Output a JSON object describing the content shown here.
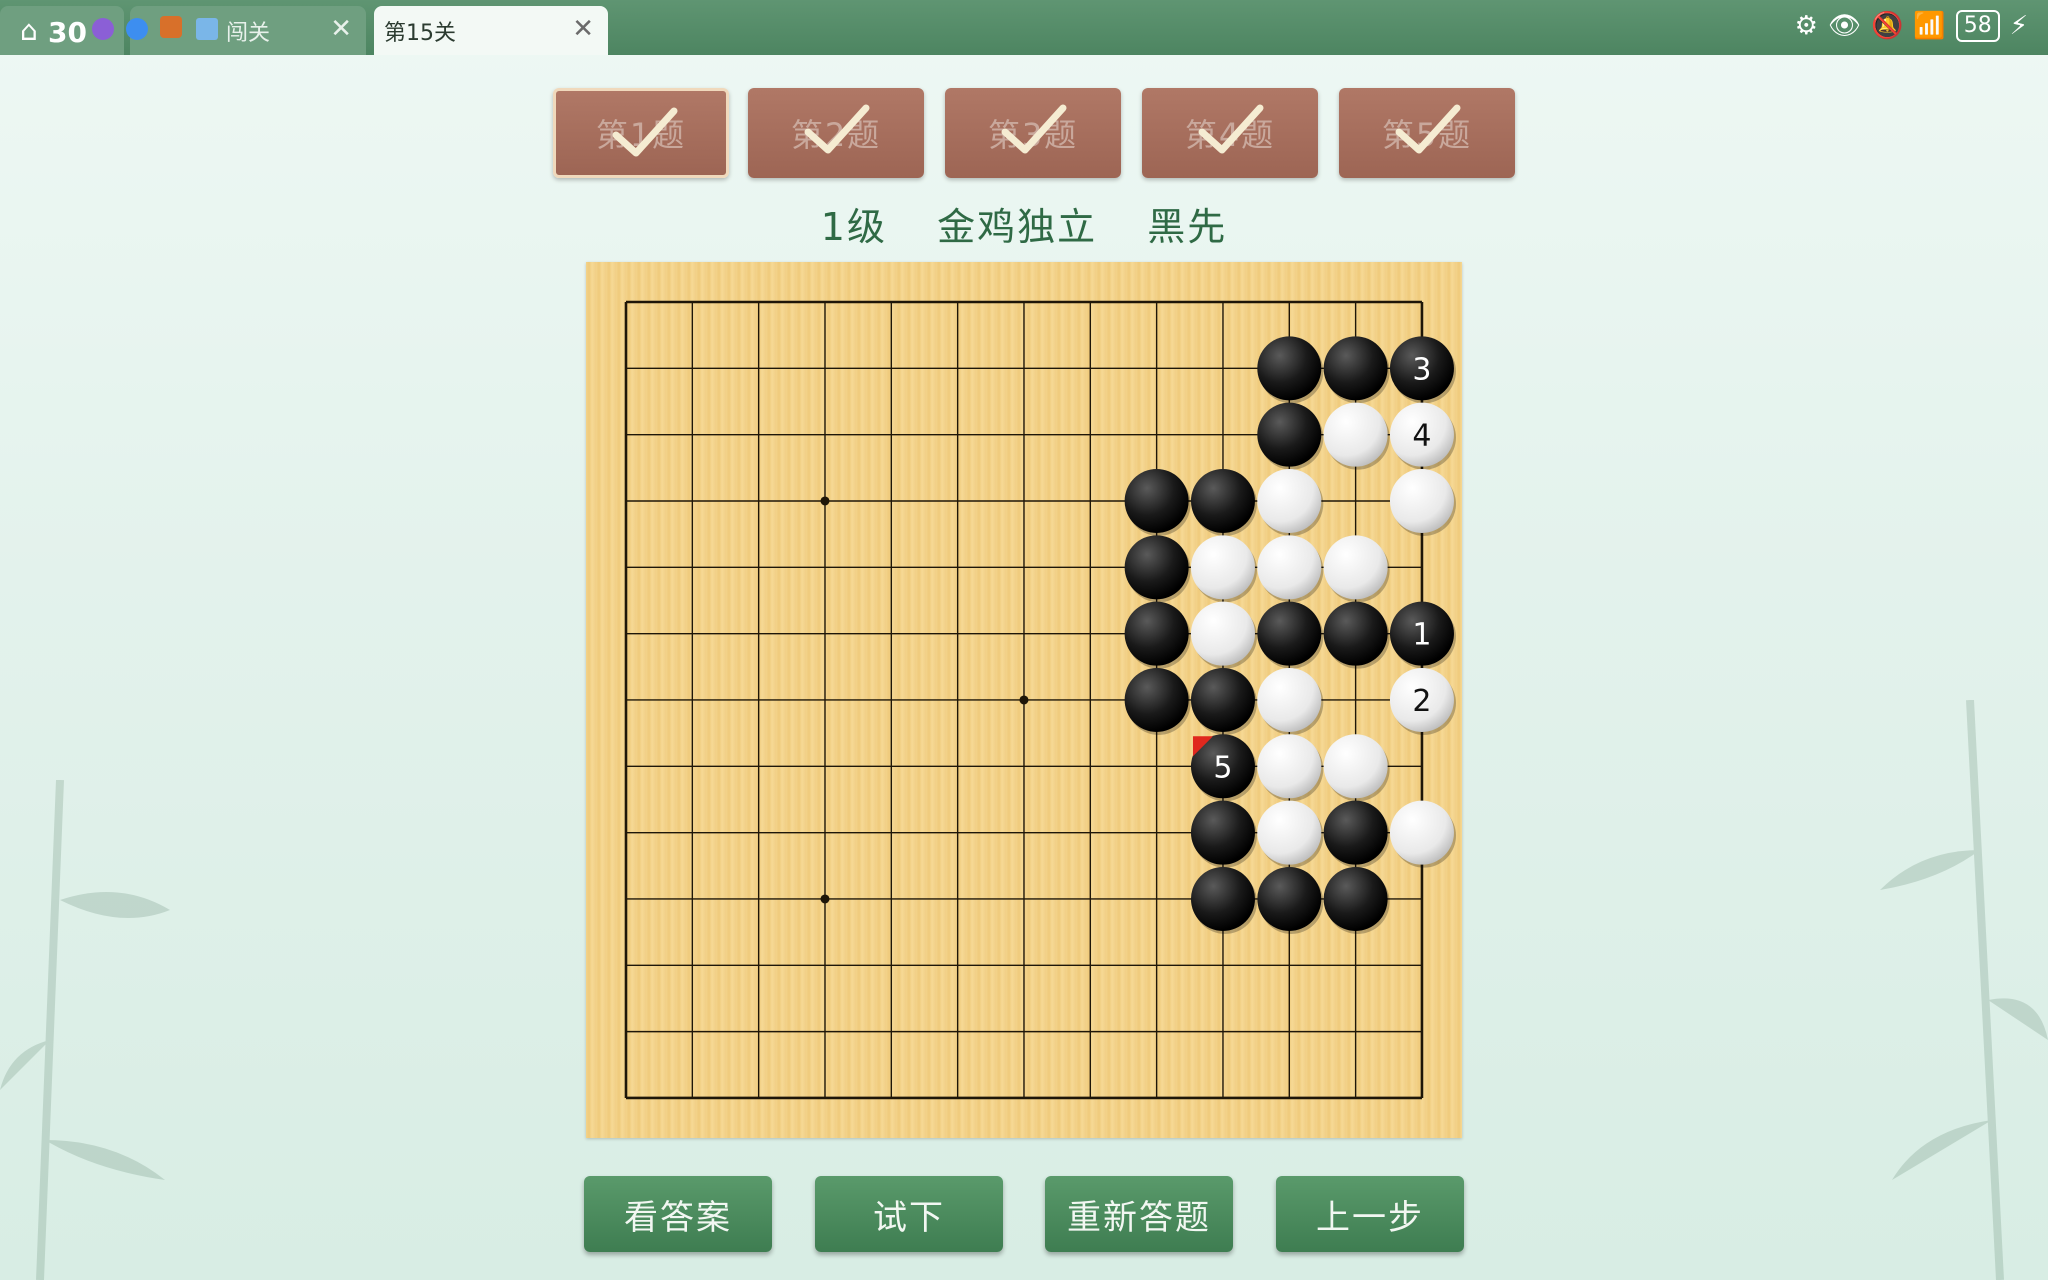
{
  "tabs": {
    "home_count": "30",
    "second_label": "闯关",
    "active_label": "第15关"
  },
  "status_bar": {
    "battery": "58"
  },
  "problems": [
    {
      "label": "第1题",
      "solved": true
    },
    {
      "label": "第2题",
      "solved": true
    },
    {
      "label": "第3题",
      "solved": true
    },
    {
      "label": "第4题",
      "solved": true
    },
    {
      "label": "第5题",
      "solved": true
    }
  ],
  "problem_info": {
    "level": "1级",
    "name": "金鸡独立",
    "turn": "黑先"
  },
  "board": {
    "size": 13,
    "star_points": [
      [
        3,
        3
      ],
      [
        6,
        6
      ],
      [
        3,
        9
      ]
    ],
    "stones": [
      {
        "col": 10,
        "row": 1,
        "color": "black"
      },
      {
        "col": 11,
        "row": 1,
        "color": "black"
      },
      {
        "col": 12,
        "row": 1,
        "color": "black",
        "number": "3"
      },
      {
        "col": 10,
        "row": 2,
        "color": "black"
      },
      {
        "col": 11,
        "row": 2,
        "color": "white"
      },
      {
        "col": 12,
        "row": 2,
        "color": "white",
        "number": "4"
      },
      {
        "col": 8,
        "row": 3,
        "color": "black"
      },
      {
        "col": 9,
        "row": 3,
        "color": "black"
      },
      {
        "col": 10,
        "row": 3,
        "color": "white"
      },
      {
        "col": 12,
        "row": 3,
        "color": "white"
      },
      {
        "col": 8,
        "row": 4,
        "color": "black"
      },
      {
        "col": 9,
        "row": 4,
        "color": "white"
      },
      {
        "col": 10,
        "row": 4,
        "color": "white"
      },
      {
        "col": 11,
        "row": 4,
        "color": "white"
      },
      {
        "col": 8,
        "row": 5,
        "color": "black"
      },
      {
        "col": 9,
        "row": 5,
        "color": "white"
      },
      {
        "col": 10,
        "row": 5,
        "color": "black"
      },
      {
        "col": 11,
        "row": 5,
        "color": "black"
      },
      {
        "col": 12,
        "row": 5,
        "color": "black",
        "number": "1"
      },
      {
        "col": 8,
        "row": 6,
        "color": "black"
      },
      {
        "col": 9,
        "row": 6,
        "color": "black"
      },
      {
        "col": 10,
        "row": 6,
        "color": "white"
      },
      {
        "col": 12,
        "row": 6,
        "color": "white",
        "number": "2"
      },
      {
        "col": 9,
        "row": 7,
        "color": "black",
        "number": "5",
        "last_move": true
      },
      {
        "col": 10,
        "row": 7,
        "color": "white"
      },
      {
        "col": 11,
        "row": 7,
        "color": "white"
      },
      {
        "col": 9,
        "row": 8,
        "color": "black"
      },
      {
        "col": 10,
        "row": 8,
        "color": "white"
      },
      {
        "col": 11,
        "row": 8,
        "color": "black"
      },
      {
        "col": 12,
        "row": 8,
        "color": "white"
      },
      {
        "col": 9,
        "row": 9,
        "color": "black"
      },
      {
        "col": 10,
        "row": 9,
        "color": "black"
      },
      {
        "col": 11,
        "row": 9,
        "color": "black"
      }
    ]
  },
  "actions": {
    "view_answer": "看答案",
    "try_move": "试下",
    "restart": "重新答题",
    "undo": "上一步"
  },
  "colors": {
    "accent_green": "#3e7d51",
    "problem_tab": "#9d6554",
    "last_move_marker": "#e0281e"
  }
}
